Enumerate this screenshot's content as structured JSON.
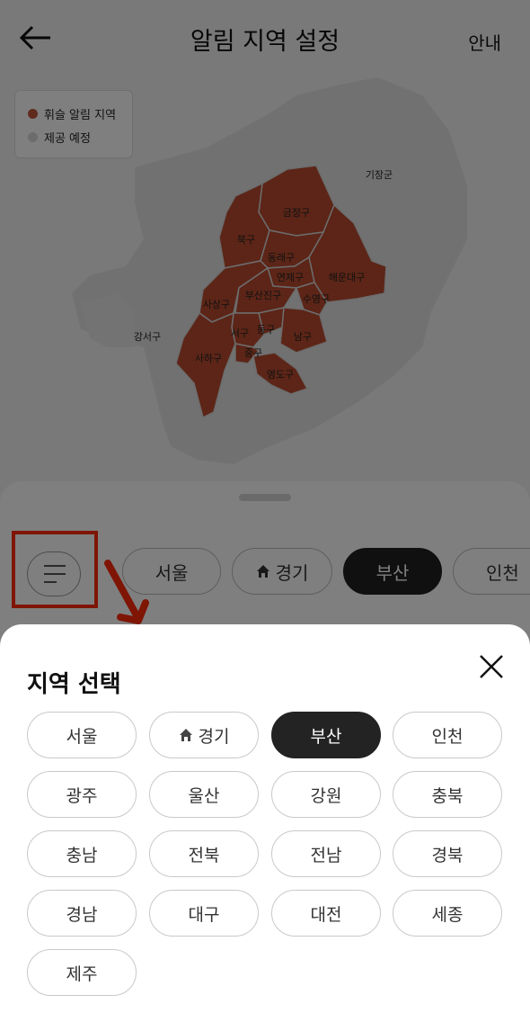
{
  "header": {
    "title": "알림 지역 설정",
    "guide_label": "안내"
  },
  "legend": {
    "items": [
      {
        "label": "휘슬 알림 지역",
        "color": "#c0573a"
      },
      {
        "label": "제공 예정",
        "color": "#d9d9d9"
      }
    ]
  },
  "map": {
    "districts": [
      "기장군",
      "금정구",
      "북구",
      "동래구",
      "연제구",
      "해운대구",
      "사상구",
      "부산진구",
      "수영구",
      "동구",
      "서구",
      "남구",
      "강서구",
      "사하구",
      "중구",
      "영도구"
    ],
    "active_color": "#c0573a",
    "inactive_color": "#e2e2e2"
  },
  "tabs": {
    "items": [
      "서울",
      "경기",
      "부산",
      "인천"
    ],
    "selected": "부산"
  },
  "modal": {
    "title": "지역 선택",
    "regions": [
      "서울",
      "경기",
      "부산",
      "인천",
      "광주",
      "울산",
      "강원",
      "충북",
      "충남",
      "전북",
      "전남",
      "경북",
      "경남",
      "대구",
      "대전",
      "세종",
      "제주"
    ],
    "selected": "부산"
  },
  "colors": {
    "highlight": "#ff2a0a",
    "selected_chip": "#202020"
  }
}
